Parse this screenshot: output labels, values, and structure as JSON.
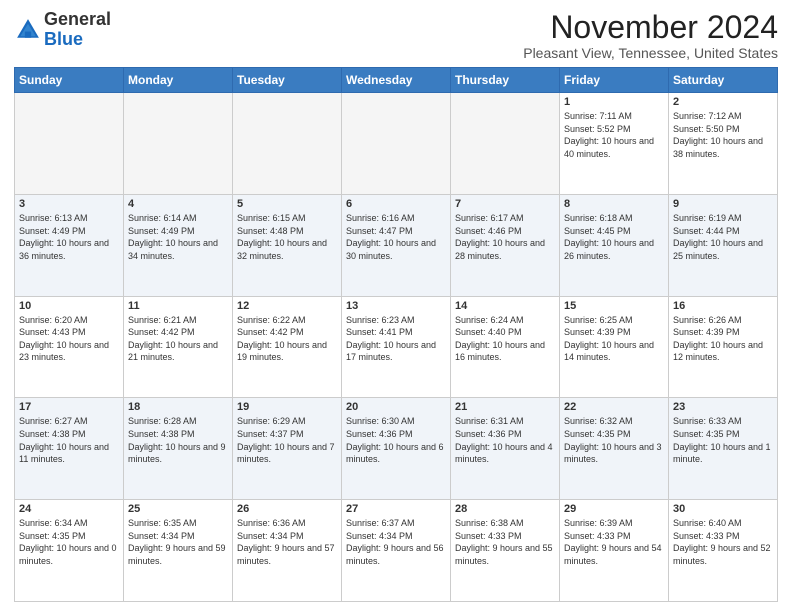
{
  "logo": {
    "general": "General",
    "blue": "Blue"
  },
  "header": {
    "month_title": "November 2024",
    "location": "Pleasant View, Tennessee, United States"
  },
  "days_of_week": [
    "Sunday",
    "Monday",
    "Tuesday",
    "Wednesday",
    "Thursday",
    "Friday",
    "Saturday"
  ],
  "weeks": [
    [
      {
        "day": "",
        "info": ""
      },
      {
        "day": "",
        "info": ""
      },
      {
        "day": "",
        "info": ""
      },
      {
        "day": "",
        "info": ""
      },
      {
        "day": "",
        "info": ""
      },
      {
        "day": "1",
        "info": "Sunrise: 7:11 AM\nSunset: 5:52 PM\nDaylight: 10 hours and 40 minutes."
      },
      {
        "day": "2",
        "info": "Sunrise: 7:12 AM\nSunset: 5:50 PM\nDaylight: 10 hours and 38 minutes."
      }
    ],
    [
      {
        "day": "3",
        "info": "Sunrise: 6:13 AM\nSunset: 4:49 PM\nDaylight: 10 hours and 36 minutes."
      },
      {
        "day": "4",
        "info": "Sunrise: 6:14 AM\nSunset: 4:49 PM\nDaylight: 10 hours and 34 minutes."
      },
      {
        "day": "5",
        "info": "Sunrise: 6:15 AM\nSunset: 4:48 PM\nDaylight: 10 hours and 32 minutes."
      },
      {
        "day": "6",
        "info": "Sunrise: 6:16 AM\nSunset: 4:47 PM\nDaylight: 10 hours and 30 minutes."
      },
      {
        "day": "7",
        "info": "Sunrise: 6:17 AM\nSunset: 4:46 PM\nDaylight: 10 hours and 28 minutes."
      },
      {
        "day": "8",
        "info": "Sunrise: 6:18 AM\nSunset: 4:45 PM\nDaylight: 10 hours and 26 minutes."
      },
      {
        "day": "9",
        "info": "Sunrise: 6:19 AM\nSunset: 4:44 PM\nDaylight: 10 hours and 25 minutes."
      }
    ],
    [
      {
        "day": "10",
        "info": "Sunrise: 6:20 AM\nSunset: 4:43 PM\nDaylight: 10 hours and 23 minutes."
      },
      {
        "day": "11",
        "info": "Sunrise: 6:21 AM\nSunset: 4:42 PM\nDaylight: 10 hours and 21 minutes."
      },
      {
        "day": "12",
        "info": "Sunrise: 6:22 AM\nSunset: 4:42 PM\nDaylight: 10 hours and 19 minutes."
      },
      {
        "day": "13",
        "info": "Sunrise: 6:23 AM\nSunset: 4:41 PM\nDaylight: 10 hours and 17 minutes."
      },
      {
        "day": "14",
        "info": "Sunrise: 6:24 AM\nSunset: 4:40 PM\nDaylight: 10 hours and 16 minutes."
      },
      {
        "day": "15",
        "info": "Sunrise: 6:25 AM\nSunset: 4:39 PM\nDaylight: 10 hours and 14 minutes."
      },
      {
        "day": "16",
        "info": "Sunrise: 6:26 AM\nSunset: 4:39 PM\nDaylight: 10 hours and 12 minutes."
      }
    ],
    [
      {
        "day": "17",
        "info": "Sunrise: 6:27 AM\nSunset: 4:38 PM\nDaylight: 10 hours and 11 minutes."
      },
      {
        "day": "18",
        "info": "Sunrise: 6:28 AM\nSunset: 4:38 PM\nDaylight: 10 hours and 9 minutes."
      },
      {
        "day": "19",
        "info": "Sunrise: 6:29 AM\nSunset: 4:37 PM\nDaylight: 10 hours and 7 minutes."
      },
      {
        "day": "20",
        "info": "Sunrise: 6:30 AM\nSunset: 4:36 PM\nDaylight: 10 hours and 6 minutes."
      },
      {
        "day": "21",
        "info": "Sunrise: 6:31 AM\nSunset: 4:36 PM\nDaylight: 10 hours and 4 minutes."
      },
      {
        "day": "22",
        "info": "Sunrise: 6:32 AM\nSunset: 4:35 PM\nDaylight: 10 hours and 3 minutes."
      },
      {
        "day": "23",
        "info": "Sunrise: 6:33 AM\nSunset: 4:35 PM\nDaylight: 10 hours and 1 minute."
      }
    ],
    [
      {
        "day": "24",
        "info": "Sunrise: 6:34 AM\nSunset: 4:35 PM\nDaylight: 10 hours and 0 minutes."
      },
      {
        "day": "25",
        "info": "Sunrise: 6:35 AM\nSunset: 4:34 PM\nDaylight: 9 hours and 59 minutes."
      },
      {
        "day": "26",
        "info": "Sunrise: 6:36 AM\nSunset: 4:34 PM\nDaylight: 9 hours and 57 minutes."
      },
      {
        "day": "27",
        "info": "Sunrise: 6:37 AM\nSunset: 4:34 PM\nDaylight: 9 hours and 56 minutes."
      },
      {
        "day": "28",
        "info": "Sunrise: 6:38 AM\nSunset: 4:33 PM\nDaylight: 9 hours and 55 minutes."
      },
      {
        "day": "29",
        "info": "Sunrise: 6:39 AM\nSunset: 4:33 PM\nDaylight: 9 hours and 54 minutes."
      },
      {
        "day": "30",
        "info": "Sunrise: 6:40 AM\nSunset: 4:33 PM\nDaylight: 9 hours and 52 minutes."
      }
    ]
  ]
}
